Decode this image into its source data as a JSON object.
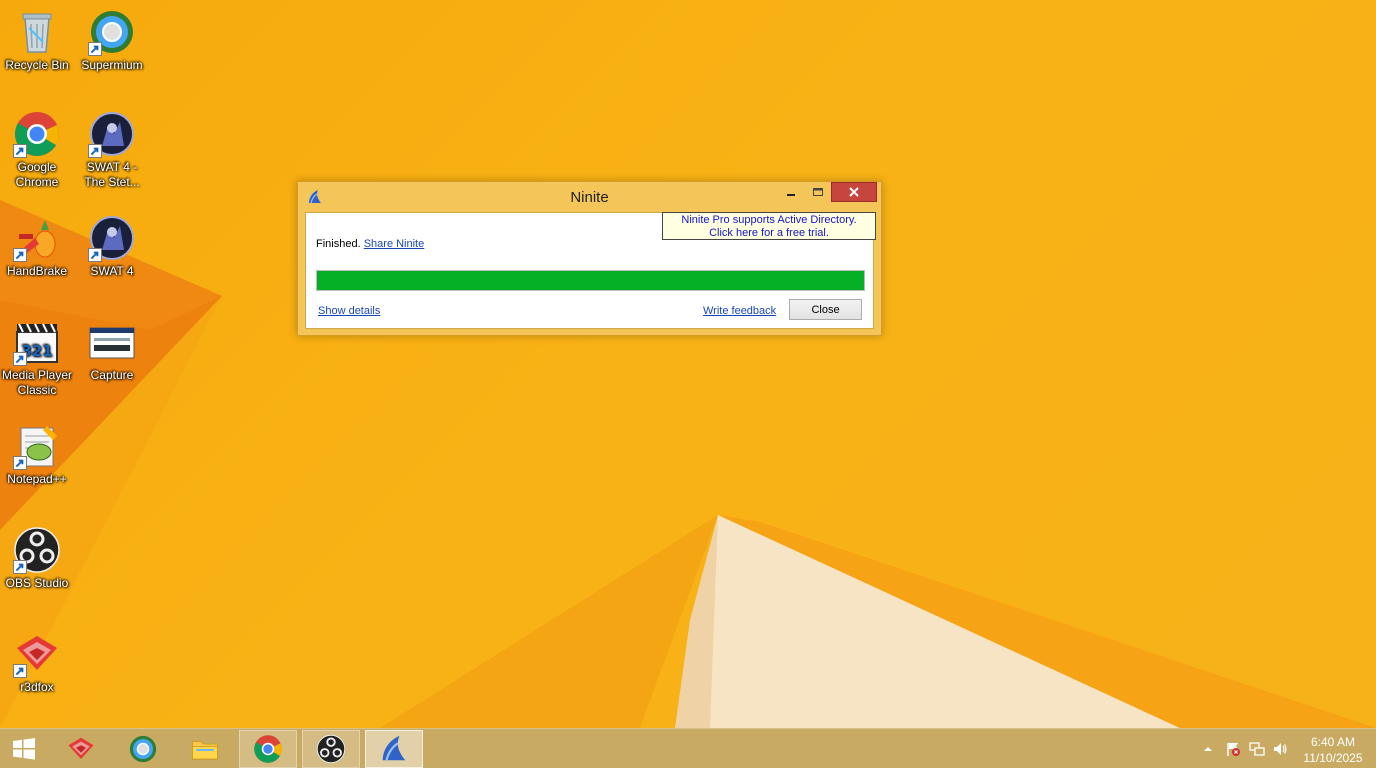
{
  "desktop": {
    "icons": [
      {
        "label": "Recycle Bin",
        "icon": "recycle-bin-icon"
      },
      {
        "label": "Supermium",
        "icon": "supermium-icon"
      },
      {
        "label": "Google Chrome",
        "icon": "chrome-icon"
      },
      {
        "label": "SWAT 4 - The Stet...",
        "icon": "swat4-stetchkov-icon"
      },
      {
        "label": "HandBrake",
        "icon": "handbrake-icon"
      },
      {
        "label": "SWAT 4",
        "icon": "swat4-icon"
      },
      {
        "label": "Media Player Classic",
        "icon": "media-player-classic-icon"
      },
      {
        "label": "Capture",
        "icon": "capture-icon"
      },
      {
        "label": "Notepad++",
        "icon": "notepad-plus-plus-icon"
      },
      {
        "label": "OBS Studio",
        "icon": "obs-studio-icon"
      },
      {
        "label": "r3dfox",
        "icon": "r3dfox-icon"
      }
    ]
  },
  "ninite": {
    "title": "Ninite",
    "ad_line1": "Ninite Pro supports Active Directory.",
    "ad_line2": "Click here for a free trial.",
    "status_text": "Finished.",
    "share_link": "Share Ninite",
    "progress_percent": 100,
    "show_details_link": "Show details",
    "feedback_link": "Write feedback",
    "close_button": "Close",
    "progress_color": "#06b025"
  },
  "taskbar": {
    "items": [
      {
        "icon": "start-windows-icon",
        "state": "idle"
      },
      {
        "icon": "r3dfox-icon",
        "state": "idle"
      },
      {
        "icon": "supermium-icon",
        "state": "idle"
      },
      {
        "icon": "file-explorer-icon",
        "state": "idle"
      },
      {
        "icon": "chrome-icon",
        "state": "running"
      },
      {
        "icon": "obs-studio-icon",
        "state": "running"
      },
      {
        "icon": "ninite-icon",
        "state": "active"
      }
    ],
    "tray_icons": [
      "show-hidden-icons-arrow",
      "action-center-flag-icon",
      "network-icon",
      "volume-icon"
    ],
    "clock_time": "6:40 AM",
    "clock_date": "11/10/2025"
  }
}
